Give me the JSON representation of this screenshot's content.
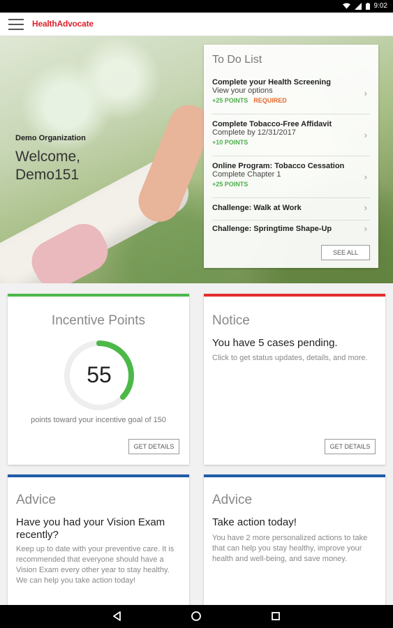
{
  "status": {
    "time": "9:02"
  },
  "app": {
    "logo": "HealthAdvocate"
  },
  "hero": {
    "org": "Demo Organization",
    "welcome": "Welcome,",
    "user": "Demo151"
  },
  "todo": {
    "title": "To Do List",
    "items": [
      {
        "title": "Complete your Health Screening",
        "sub": "View your options",
        "points": "+25 POINTS",
        "tag": "REQUIRED"
      },
      {
        "title": "Complete Tobacco-Free Affidavit",
        "sub": "Complete by 12/31/2017",
        "points": "+10 POINTS"
      },
      {
        "title": "Online Program: Tobacco Cessation",
        "sub": "Complete Chapter 1",
        "points": "+25 POINTS"
      },
      {
        "title": "Challenge: Walk at Work"
      },
      {
        "title": "Challenge: Springtime Shape-Up"
      }
    ],
    "see_all": "SEE ALL"
  },
  "incentive": {
    "title": "Incentive Points",
    "value": "55",
    "goal": 150,
    "progress_fraction": 0.367,
    "caption": "points toward your incentive goal of 150",
    "button": "GET DETAILS",
    "accent": "#4cb848"
  },
  "notice": {
    "title": "Notice",
    "headline": "You have 5 cases pending.",
    "body": "Click to get status updates, details, and more.",
    "button": "GET DETAILS",
    "accent": "#e52d2d"
  },
  "advice1": {
    "title": "Advice",
    "headline": "Have you had your Vision Exam recently?",
    "body": "Keep up to date with your preventive care. It is recommended that everyone should have a Vision Exam every other year to stay healthy. We can help you take action today!",
    "accent": "#1f5aa8"
  },
  "advice2": {
    "title": "Advice",
    "headline": "Take action today!",
    "body": "You have 2 more personalized actions to take that can help you stay healthy, improve your health and well-being, and save money.",
    "accent": "#1f5aa8"
  },
  "icons": {
    "status": [
      "wifi-icon",
      "signal-icon",
      "battery-icon"
    ],
    "nav": [
      "back-icon",
      "home-icon",
      "recents-icon"
    ]
  }
}
